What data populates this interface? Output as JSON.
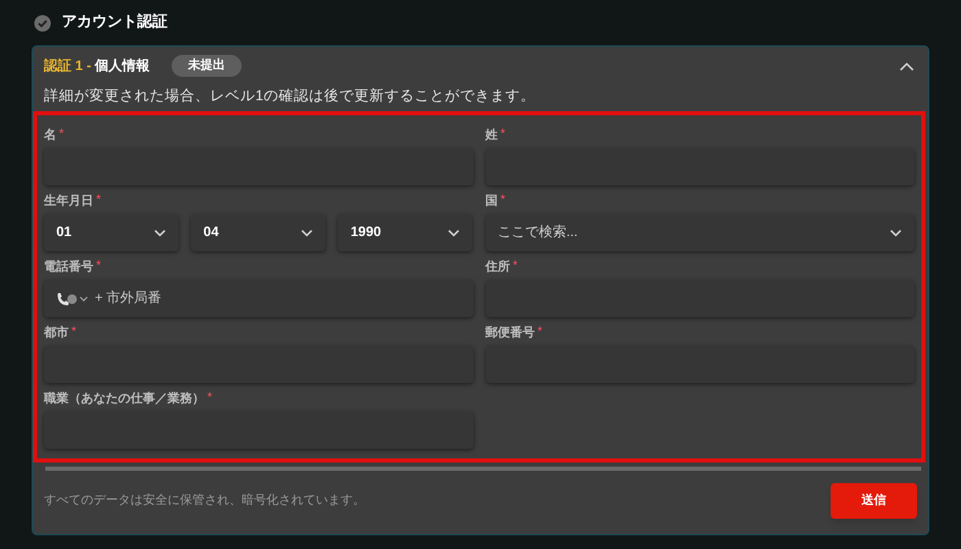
{
  "page_title": "アカウント認証",
  "section": {
    "step": "認証 1 -",
    "title": "個人情報",
    "badge": "未提出",
    "expanded": true,
    "description": "詳細が変更された場合、レベル1の確認は後で更新することができます。"
  },
  "fields": [
    {
      "kind": "text",
      "label": "名",
      "mark": "*"
    },
    {
      "kind": "text",
      "label": "姓",
      "mark": "*"
    },
    {
      "kind": "date",
      "label": "生年月日",
      "mark": "*",
      "parts": [
        "01",
        "04",
        "1990"
      ]
    },
    {
      "kind": "select",
      "label": "国",
      "mark": "*",
      "placeholder": "ここで検索..."
    },
    {
      "kind": "phone",
      "label": "電話番号",
      "mark": "*",
      "placeholder": "+ 市外局番"
    },
    {
      "kind": "text",
      "label": "住所",
      "mark": "*"
    },
    {
      "kind": "text",
      "label": "都市",
      "mark": "*"
    },
    {
      "kind": "text",
      "label": "郵便番号",
      "mark": "*"
    },
    {
      "kind": "text",
      "label": "職業（あなたの仕事／業務）",
      "mark": "*"
    }
  ],
  "footer": {
    "note": "すべてのデータは安全に保管され、暗号化されています。",
    "submit": "送信"
  }
}
